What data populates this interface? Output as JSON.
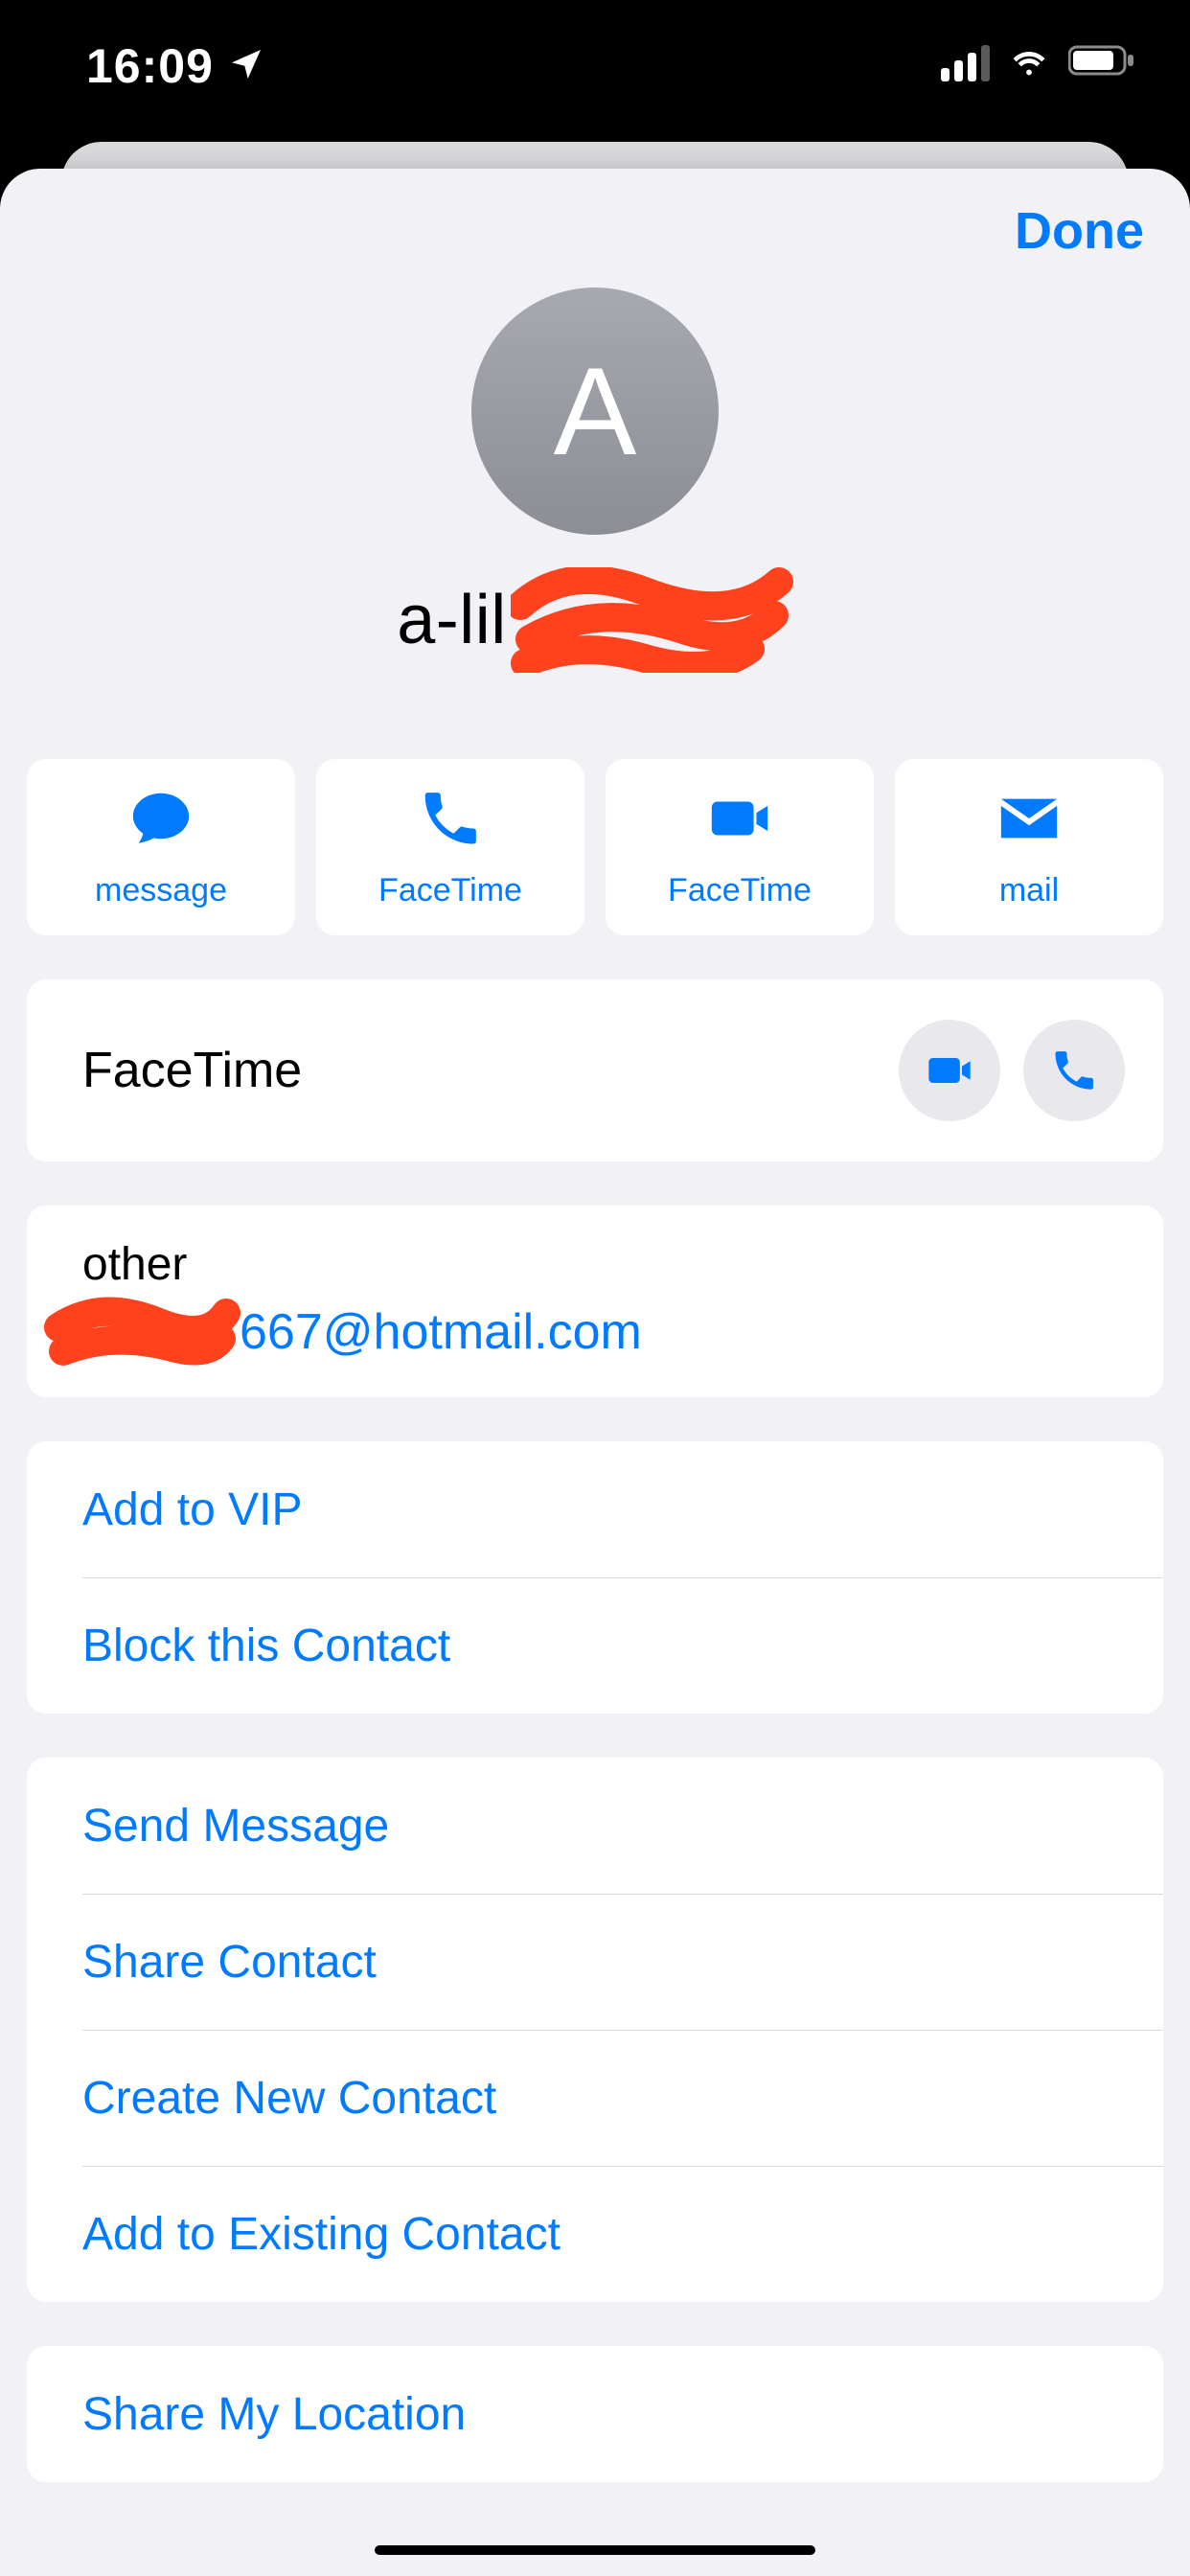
{
  "status": {
    "time": "16:09"
  },
  "nav": {
    "done": "Done"
  },
  "profile": {
    "initial": "A",
    "name_visible": "a-lil"
  },
  "actions": {
    "message": "message",
    "facetime_audio": "FaceTime",
    "facetime_video": "FaceTime",
    "mail": "mail"
  },
  "facetime": {
    "label": "FaceTime"
  },
  "email": {
    "label": "other",
    "value_visible": "667@hotmail.com"
  },
  "links": {
    "add_vip": "Add to VIP",
    "block": "Block this Contact",
    "send_message": "Send Message",
    "share_contact": "Share Contact",
    "create_new": "Create New Contact",
    "add_existing": "Add to Existing Contact",
    "share_location": "Share My Location"
  },
  "colors": {
    "accent": "#007aff",
    "redaction": "#fd421d"
  }
}
